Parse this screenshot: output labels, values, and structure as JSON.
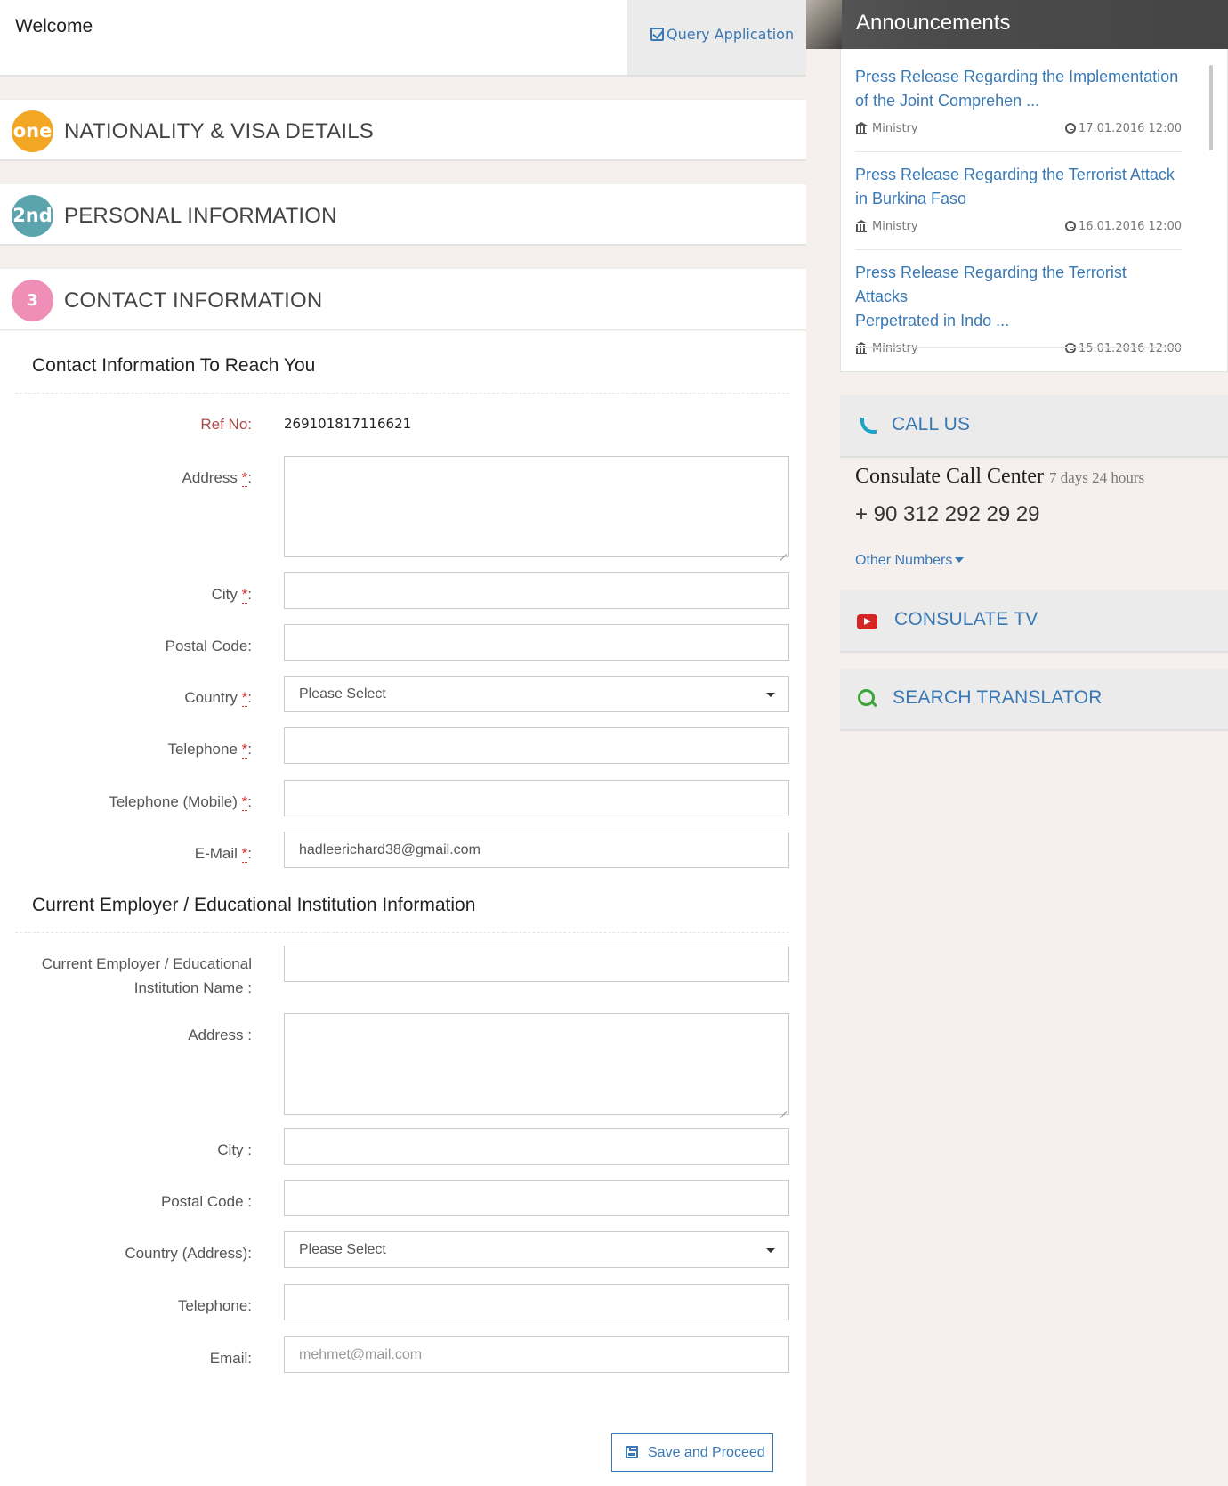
{
  "header": {
    "welcome": "Welcome",
    "query_application": "Query Application"
  },
  "steps": [
    {
      "badge": "one",
      "title": "NATIONALITY & VISA DETAILS",
      "color": "#f2a624"
    },
    {
      "badge": "2nd",
      "title": "PERSONAL INFORMATION",
      "color": "#5ba3ad"
    },
    {
      "badge": "3",
      "title": "CONTACT INFORMATION",
      "color": "#ef8fb8"
    }
  ],
  "contact": {
    "section_title": "Contact Information To Reach You",
    "ref_label": "Ref No:",
    "ref_value": "269101817116621",
    "address_label": "Address",
    "city_label": "City",
    "postal_label": "Postal Code:",
    "country_label": "Country",
    "country_value": "Please Select",
    "telephone_label": "Telephone",
    "mobile_label": "Telephone (Mobile)",
    "email_label": "E-Mail",
    "email_value": "hadleerichard38@gmail.com",
    "required_mark": "*",
    "colon": ":"
  },
  "employer": {
    "section_title": "Current Employer / Educational Institution Information",
    "name_label_line1": "Current Employer / Educational",
    "name_label_line2": "Institution Name :",
    "address_label": "Address :",
    "city_label": "City :",
    "postal_label": "Postal Code :",
    "country_label": "Country (Address):",
    "country_value": "Please Select",
    "telephone_label": "Telephone:",
    "email_label": "Email:",
    "email_placeholder": "mehmet@mail.com"
  },
  "save_button": "Save and Proceed",
  "announcements": {
    "title": "Announcements",
    "items": [
      {
        "line1": "Press Release Regarding the Implementation",
        "line2": "of the Joint Comprehen ...",
        "source": "Ministry",
        "date": "17.01.2016 12:00"
      },
      {
        "line1": "Press Release Regarding the Terrorist Attack",
        "line2": "in Burkina Faso",
        "source": "Ministry",
        "date": "16.01.2016 12:00"
      },
      {
        "line1": "Press Release Regarding the Terrorist Attacks",
        "line2": "Perpetrated in Indo ...",
        "source": "Ministry",
        "date": "15.01.2016 12:00"
      }
    ]
  },
  "call_us": {
    "label": "CALL US",
    "center_name": "Consulate Call Center",
    "hours": "7 days 24 hours",
    "phone": "+ 90 312 292 29 29",
    "other_numbers": "Other Numbers"
  },
  "consulate_tv": "CONSULATE TV",
  "search_translator": "SEARCH TRANSLATOR",
  "colors": {
    "link_blue": "#3a78b4",
    "required_red": "#d33333",
    "youtube_red": "#d42424",
    "search_green": "#3aa53a",
    "phone_teal": "#1aa3c7"
  }
}
